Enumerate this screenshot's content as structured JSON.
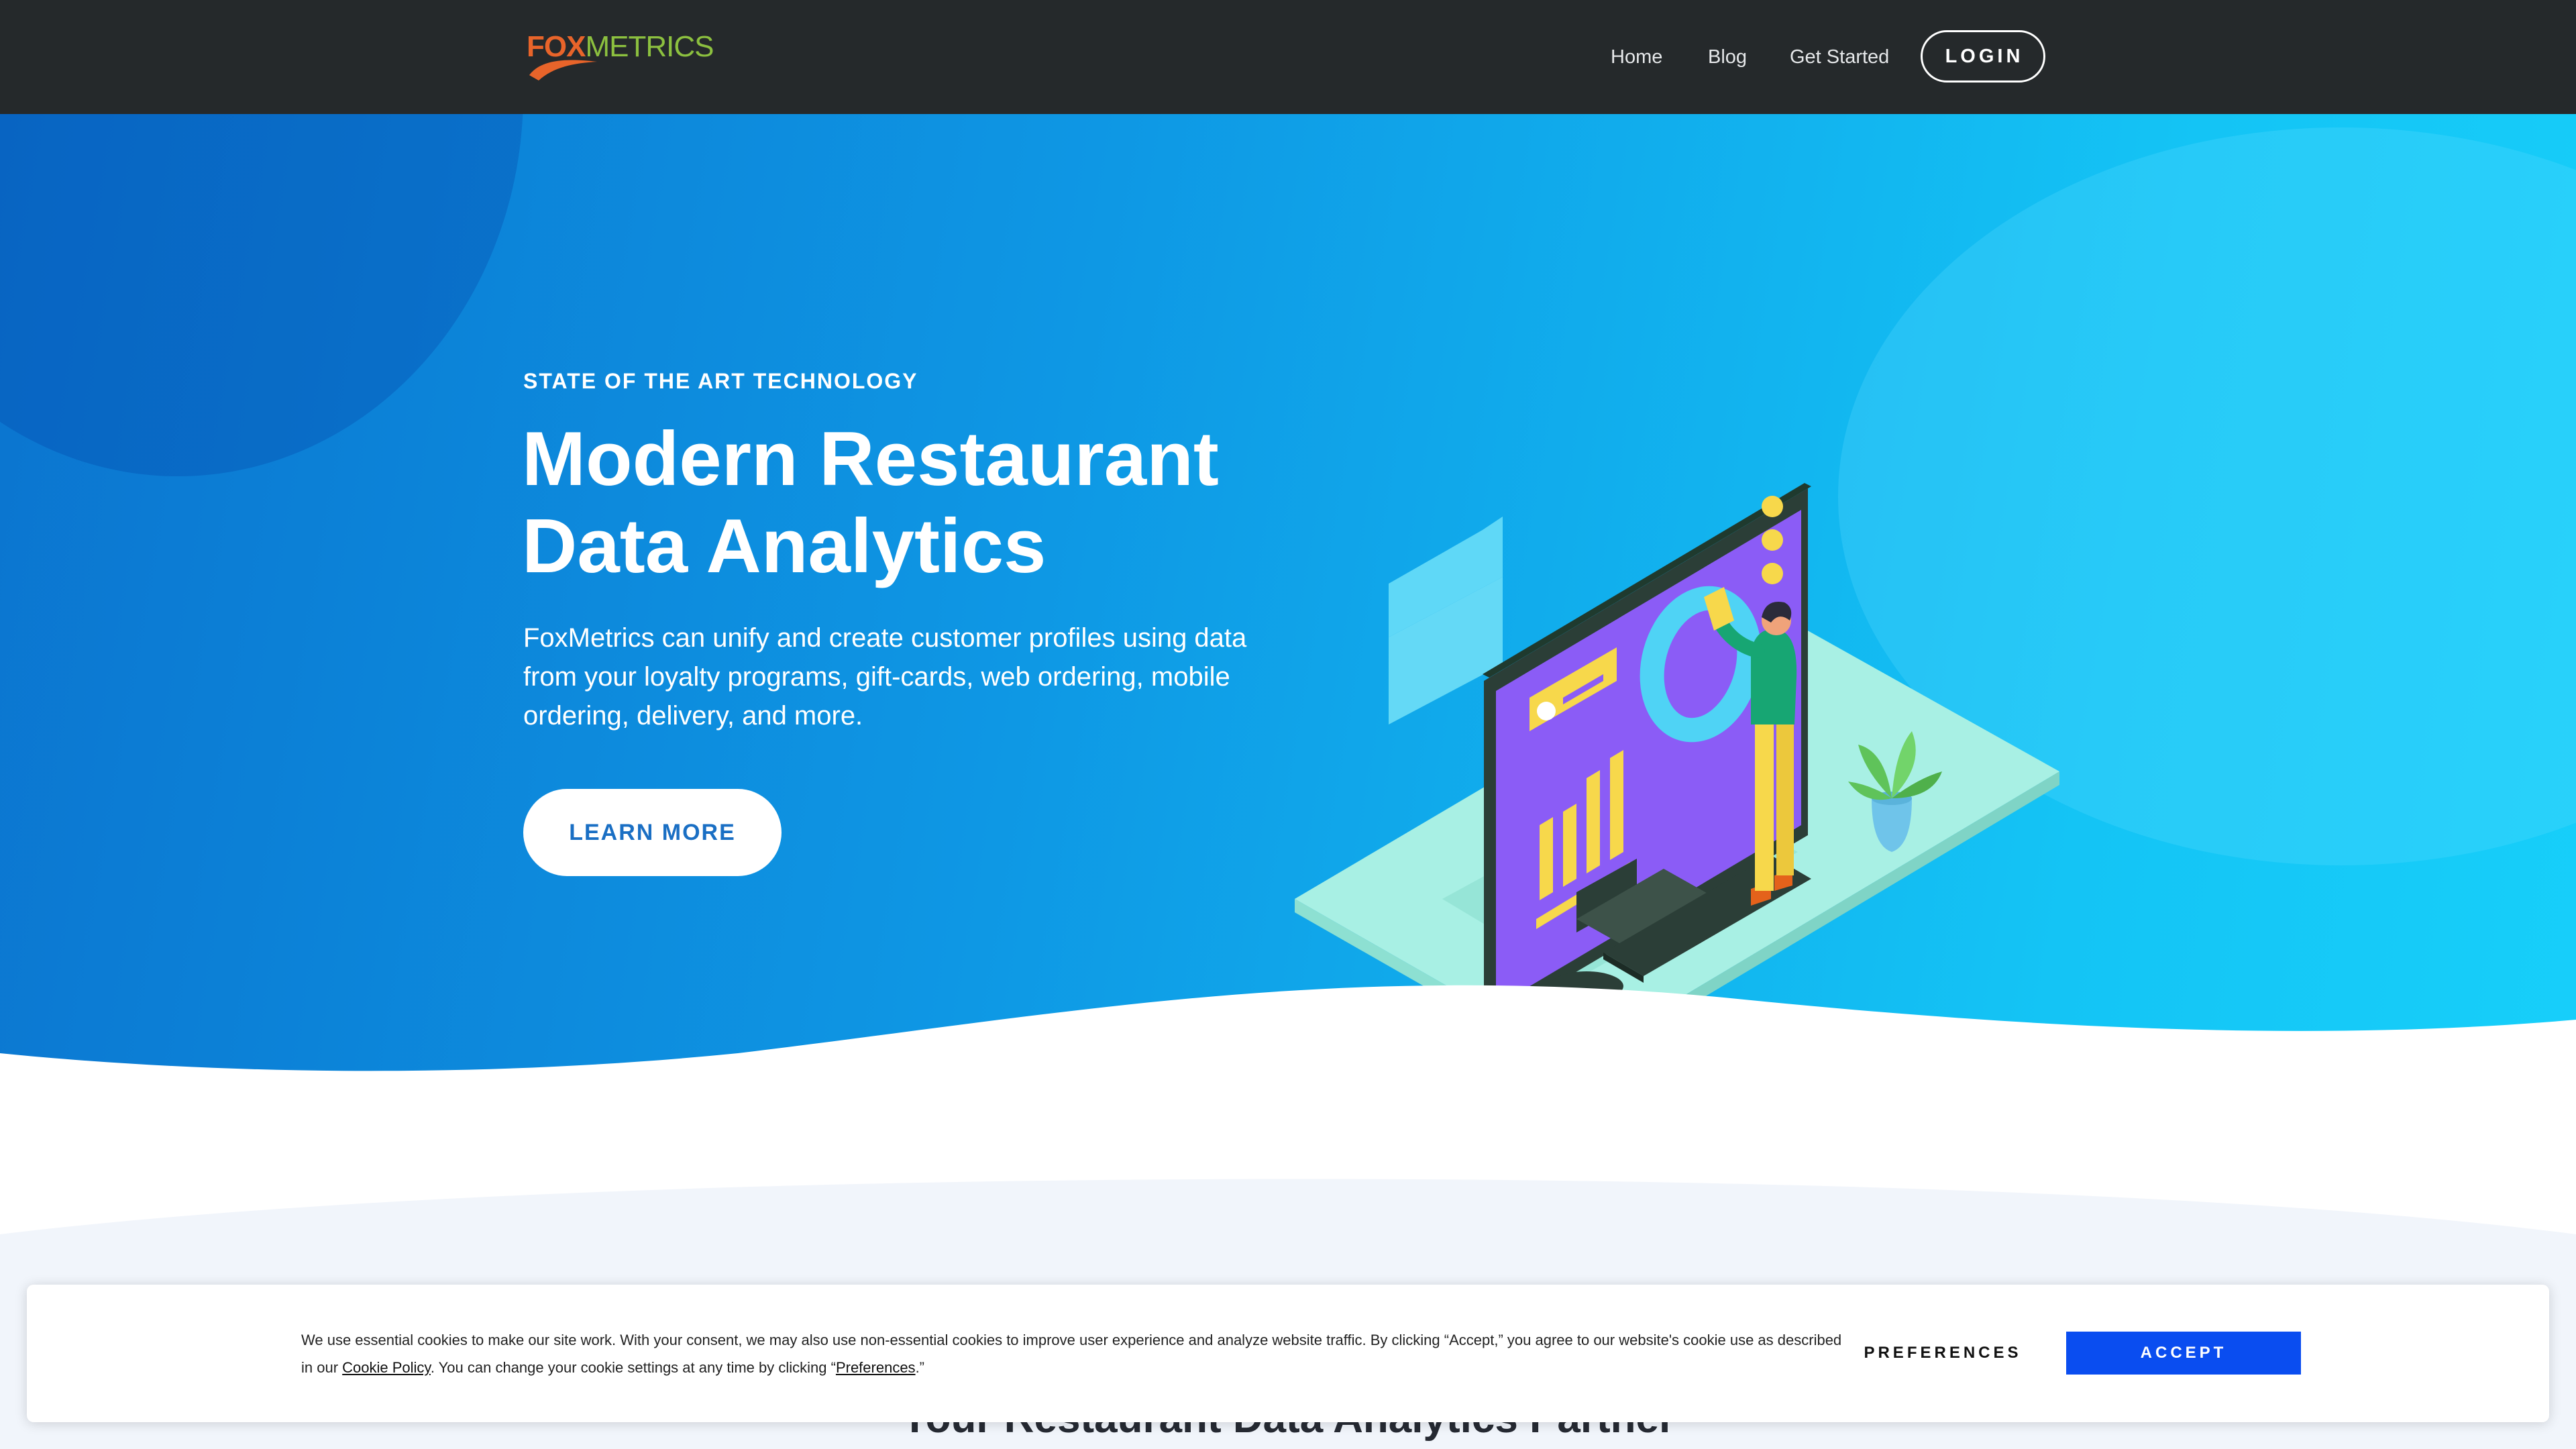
{
  "nav": {
    "logo_fox": "FOX",
    "logo_metrics": "METRICS",
    "home": "Home",
    "blog": "Blog",
    "get_started": "Get Started",
    "login": "LOGIN"
  },
  "hero": {
    "eyebrow": "STATE OF THE ART TECHNOLOGY",
    "title_line1": "Modern Restaurant",
    "title_line2": "Data Analytics",
    "description": "FoxMetrics can unify and create customer profiles using data from your loyalty programs, gift-cards, web ordering, mobile ordering, delivery, and more.",
    "cta": "LEARN MORE"
  },
  "section": {
    "heading": "Your Restaurant Data Analytics Partner"
  },
  "cookie_banner": {
    "text_1": "We use essential cookies to make our site work. With your consent, we may also use non-essential cookies to improve user experience and analyze website traffic. By clicking “Accept,” you agree to our website's cookie use as described in our ",
    "cookie_policy_link": "Cookie Policy",
    "text_2": ". You can change your cookie settings at any time by clicking “",
    "preferences_link": "Preferences",
    "text_3": ".”",
    "preferences_button": "PREFERENCES",
    "accept_button": "ACCEPT"
  },
  "colors": {
    "navbar": "#25292b",
    "hero_start": "#0b74cf",
    "hero_end": "#17cffa",
    "accept": "#0a4df0",
    "logo_fox": "#e8642a",
    "logo_metrics": "#8cc03f"
  },
  "icons": [
    "foxmetrics-logo",
    "analytics-illustration"
  ]
}
